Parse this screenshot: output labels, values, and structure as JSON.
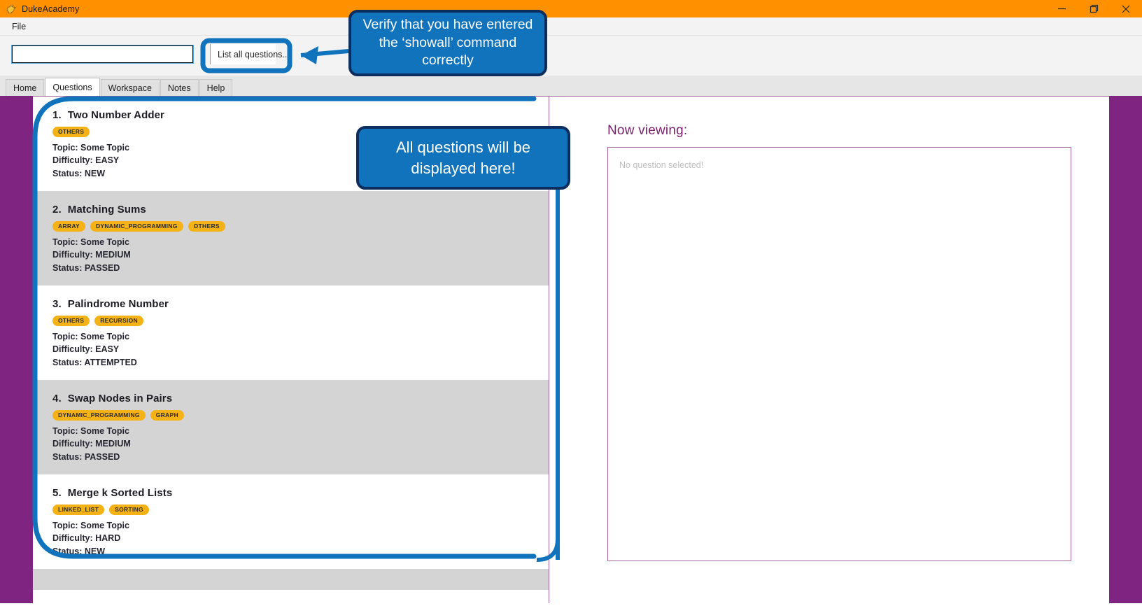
{
  "window": {
    "title": "DukeAcademy",
    "icon": "duck-icon",
    "titlebar_color": "#ff9000",
    "controls": [
      {
        "name": "minimize",
        "glyph": "minimize-icon"
      },
      {
        "name": "restore",
        "glyph": "restore-icon"
      },
      {
        "name": "close",
        "glyph": "close-icon"
      }
    ]
  },
  "menubar": {
    "items": [
      {
        "label": "File"
      }
    ]
  },
  "command_bar": {
    "input_value": "",
    "input_placeholder": "",
    "result_text": "List all questions...",
    "wide_field_value": ""
  },
  "tabs": {
    "active": "Questions",
    "items": [
      {
        "label": "Home"
      },
      {
        "label": "Questions"
      },
      {
        "label": "Workspace"
      },
      {
        "label": "Notes"
      },
      {
        "label": "Help"
      }
    ]
  },
  "question_list": {
    "items": [
      {
        "number": "1.",
        "title": "Two Number Adder",
        "tags": [
          "OTHERS"
        ],
        "topic": "Topic: Some Topic",
        "difficulty": "Difficulty: EASY",
        "status": "Status: NEW"
      },
      {
        "number": "2.",
        "title": "Matching Sums",
        "tags": [
          "ARRAY",
          "DYNAMIC_PROGRAMMING",
          "OTHERS"
        ],
        "topic": "Topic: Some Topic",
        "difficulty": "Difficulty: MEDIUM",
        "status": "Status: PASSED"
      },
      {
        "number": "3.",
        "title": "Palindrome Number",
        "tags": [
          "OTHERS",
          "RECURSION"
        ],
        "topic": "Topic: Some Topic",
        "difficulty": "Difficulty: EASY",
        "status": "Status: ATTEMPTED"
      },
      {
        "number": "4.",
        "title": "Swap Nodes in Pairs",
        "tags": [
          "DYNAMIC_PROGRAMMING",
          "GRAPH"
        ],
        "topic": "Topic: Some Topic",
        "difficulty": "Difficulty: MEDIUM",
        "status": "Status: PASSED"
      },
      {
        "number": "5.",
        "title": "Merge k Sorted Lists",
        "tags": [
          "LINKED_LIST",
          "SORTING"
        ],
        "topic": "Topic: Some Topic",
        "difficulty": "Difficulty: HARD",
        "status": "Status: NEW"
      }
    ]
  },
  "viewer": {
    "heading": "Now viewing:",
    "empty_message": "No question selected!"
  },
  "annotations": [
    {
      "id": "callout-showall",
      "text": "Verify that you have entered the ‘showall’ command correctly"
    },
    {
      "id": "callout-list",
      "text": "All questions will be displayed here!"
    }
  ],
  "colors": {
    "accent_orange": "#ff9000",
    "tag_yellow": "#f5b216",
    "purple": "#7f2480",
    "callout_blue": "#1073bc",
    "callout_border": "#0d2d5e"
  }
}
